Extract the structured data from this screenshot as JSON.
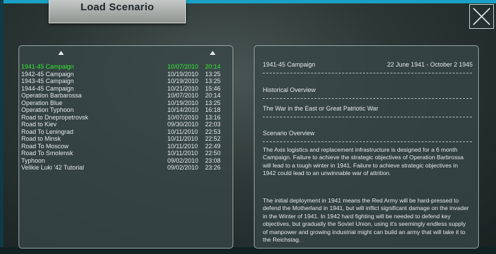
{
  "window": {
    "load_button_label": "Load Scenario",
    "close_icon": "close-icon"
  },
  "scenarios": [
    {
      "name": "1941-45 Campaign",
      "date": "10/07/2010",
      "time": "20:14",
      "selected": true
    },
    {
      "name": "1942-45 Campaign",
      "date": "10/19/2010",
      "time": "13:25"
    },
    {
      "name": "1943-45 Campaign",
      "date": "10/19/2010",
      "time": "13:25"
    },
    {
      "name": "1944-45 Campaign",
      "date": "10/21/2010",
      "time": "15:46"
    },
    {
      "name": "Operation Barbarossa",
      "date": "10/07/2010",
      "time": "20:14"
    },
    {
      "name": "Operation Blue",
      "date": "10/19/2010",
      "time": "13:25"
    },
    {
      "name": "Operation Typhoon",
      "date": "10/14/2010",
      "time": "16:18"
    },
    {
      "name": "Road to Dnepropetrovsk",
      "date": "10/07/2010",
      "time": "13:16"
    },
    {
      "name": "Road to Kiev",
      "date": "09/30/2010",
      "time": "22:03"
    },
    {
      "name": "Road To Leningrad",
      "date": "10/11/2010",
      "time": "22:53"
    },
    {
      "name": "Road to Minsk",
      "date": "10/11/2010",
      "time": "22:52"
    },
    {
      "name": "Road To Moscow",
      "date": "10/11/2010",
      "time": "22:49"
    },
    {
      "name": "Road To Smolensk",
      "date": "10/11/2010",
      "time": "22:50"
    },
    {
      "name": "Typhoon",
      "date": "09/02/2010",
      "time": "23:08"
    },
    {
      "name": "Velikie Luki '42 Tutorial",
      "date": "09/02/2010",
      "time": "23:26"
    }
  ],
  "details": {
    "title": "1941-45 Campaign",
    "date_range": "22 June 1941 - October 2 1945",
    "historical_heading": "Historical Overview",
    "historical_text": "The War in the East or Great Patriotic War",
    "scenario_heading": "Scenario Overview",
    "paragraph1": "The Axis logistics and replacement infrastructure is designed for a 6 month Campaign. Failure to achieve the strategic objectives of Operation Barbrossa will lead to a tough winter in 1941. Failure to achieve strategic objectives in 1942 could lead to an unwinnable war of attrition.",
    "paragraph2": "The initial deployment in 1941 means the Red Army will be hard-pressed to defend the Motherland in 1941, but will inflict significant damage on the invader in the Winter of 1941. In 1942 hard fighting will be needed to defend key objectives, but gradually the Soviet Union, using it's seemingly endless supply of manpower and growing industrial might can build an army that will take it to the Reichstag."
  }
}
